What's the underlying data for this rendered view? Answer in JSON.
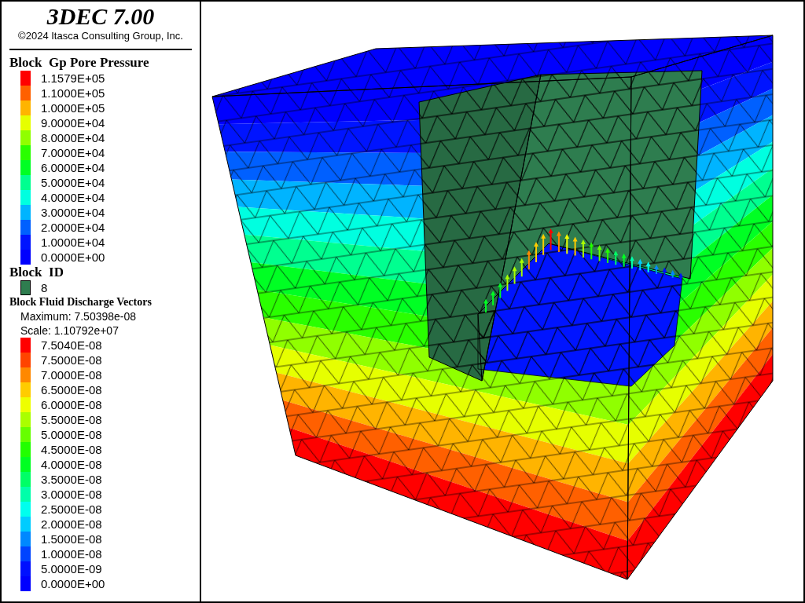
{
  "title": "3DEC 7.00",
  "copyright": "©2024 Itasca Consulting Group, Inc.",
  "pressure_legend": {
    "title": "Block  Gp Pore Pressure",
    "items": [
      {
        "label": "1.1579E+05",
        "color": "#ff0000"
      },
      {
        "label": "1.1000E+05",
        "color": "#ff6000"
      },
      {
        "label": "1.0000E+05",
        "color": "#ffb400"
      },
      {
        "label": "9.0000E+04",
        "color": "#e6ff00"
      },
      {
        "label": "8.0000E+04",
        "color": "#90ff00"
      },
      {
        "label": "7.0000E+04",
        "color": "#2aff00"
      },
      {
        "label": "6.0000E+04",
        "color": "#00ff24"
      },
      {
        "label": "5.0000E+04",
        "color": "#00ff90"
      },
      {
        "label": "4.0000E+04",
        "color": "#00ffe0"
      },
      {
        "label": "3.0000E+04",
        "color": "#00b4ff"
      },
      {
        "label": "2.0000E+04",
        "color": "#0060ff"
      },
      {
        "label": "1.0000E+04",
        "color": "#0014ff"
      },
      {
        "label": "0.0000E+00",
        "color": "#0000fe"
      }
    ]
  },
  "block_id_legend": {
    "title": "Block  ID",
    "items": [
      {
        "label": "8",
        "color": "#2e7d4f"
      }
    ]
  },
  "discharge_legend": {
    "title": "Block Fluid Discharge Vectors",
    "maximum": "Maximum: 7.50398e-08",
    "scale": "Scale: 1.10792e+07",
    "items": [
      {
        "label": "7.5040E-08",
        "color": "#ff0000"
      },
      {
        "label": "7.5000E-08",
        "color": "#ff4400"
      },
      {
        "label": "7.0000E-08",
        "color": "#ff8800"
      },
      {
        "label": "6.5000E-08",
        "color": "#ffcc00"
      },
      {
        "label": "6.0000E-08",
        "color": "#eeff00"
      },
      {
        "label": "5.5000E-08",
        "color": "#aaff00"
      },
      {
        "label": "5.0000E-08",
        "color": "#66ff00"
      },
      {
        "label": "4.5000E-08",
        "color": "#22ff00"
      },
      {
        "label": "4.0000E-08",
        "color": "#00ff22"
      },
      {
        "label": "3.5000E-08",
        "color": "#00ff66"
      },
      {
        "label": "3.0000E-08",
        "color": "#00ffaa"
      },
      {
        "label": "2.5000E-08",
        "color": "#00ffee"
      },
      {
        "label": "2.0000E-08",
        "color": "#00ccff"
      },
      {
        "label": "1.5000E-08",
        "color": "#0088ff"
      },
      {
        "label": "1.0000E-08",
        "color": "#0044ff"
      },
      {
        "label": "5.0000E-09",
        "color": "#0010ff"
      },
      {
        "label": "0.0000E+00",
        "color": "#0000ff"
      }
    ]
  }
}
